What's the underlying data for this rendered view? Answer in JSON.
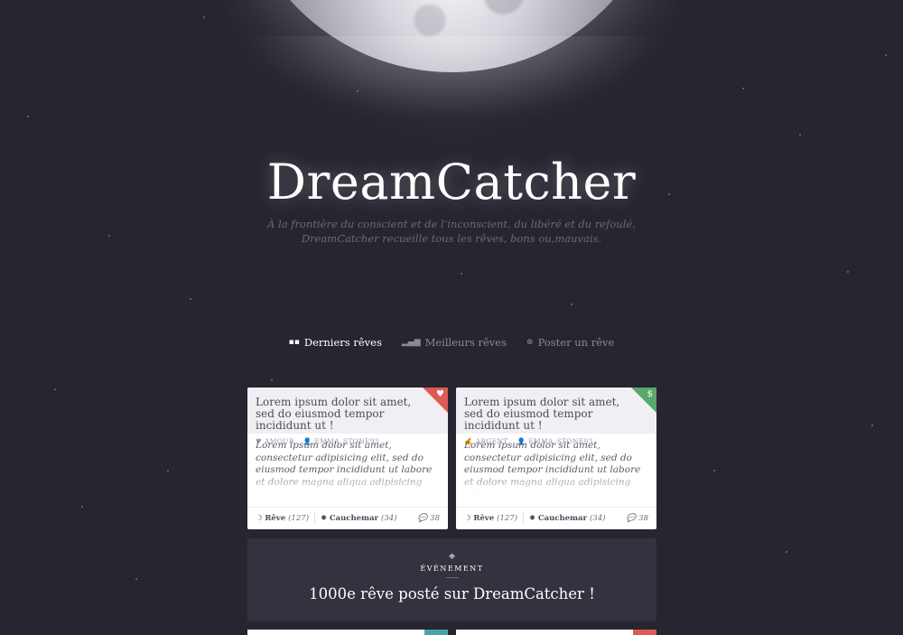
{
  "brand": {
    "title": "DreamCatcher"
  },
  "tagline": {
    "line1": "À la frontière du conscient et de l’inconscient, du libéré et du refoulé,",
    "line2": "DreamCatcher recueille tous les rêves, bons ou,mauvais."
  },
  "nav": {
    "items": [
      {
        "label": "Derniers rêves",
        "icon": "grid-icon"
      },
      {
        "label": "Meilleurs rêves",
        "icon": "bar-chart-icon"
      },
      {
        "label": "Poster un rêve",
        "icon": "plus-circle-icon"
      }
    ]
  },
  "cards": [
    {
      "title": "Lorem ipsum dolor sit amet, sed do eiusmod tempor incididunt ut !",
      "category": "AMOUR",
      "category_icon": "heart-icon",
      "author": "EMMA_STONE93",
      "corner_color": "#e05a55",
      "corner_icon": "heart-icon",
      "body": "Lorem ipsum dolor sit amet, consectetur adipisicing elit, sed do eiusmod tempor incididunt ut labore et dolore magna aliqua adipisicing elit, sed do eiusmod",
      "dream_label": "Rêve",
      "dream_count": "(127)",
      "nightmare_label": "Cauchemar",
      "nightmare_count": "(34)",
      "comments": "38"
    },
    {
      "title": "Lorem ipsum dolor sit amet, sed do eiusmod tempor incididunt ut !",
      "category": "ARGENT",
      "category_icon": "money-bag-icon",
      "author": "EMMA_STONE93",
      "corner_color": "#5aa86a",
      "corner_icon": "money-bag-icon",
      "body": "Lorem ipsum dolor sit amet, consectetur adipisicing elit, sed do eiusmod tempor incididunt ut labore et dolore magna aliqua adipisicing elit, sed do eiusmod",
      "dream_label": "Rêve",
      "dream_count": "(127)",
      "nightmare_label": "Cauchemar",
      "nightmare_count": "(34)",
      "comments": "38"
    }
  ],
  "event": {
    "label": "ÉVÉNEMENT",
    "title": "1000e rêve posté sur DreamCatcher !"
  },
  "colors": {
    "background": "#262530",
    "event_bg": "#33323e",
    "love": "#e05a55",
    "money": "#5aa86a",
    "peek_teal": "#4aa3a8",
    "peek_red": "#e05a55"
  }
}
